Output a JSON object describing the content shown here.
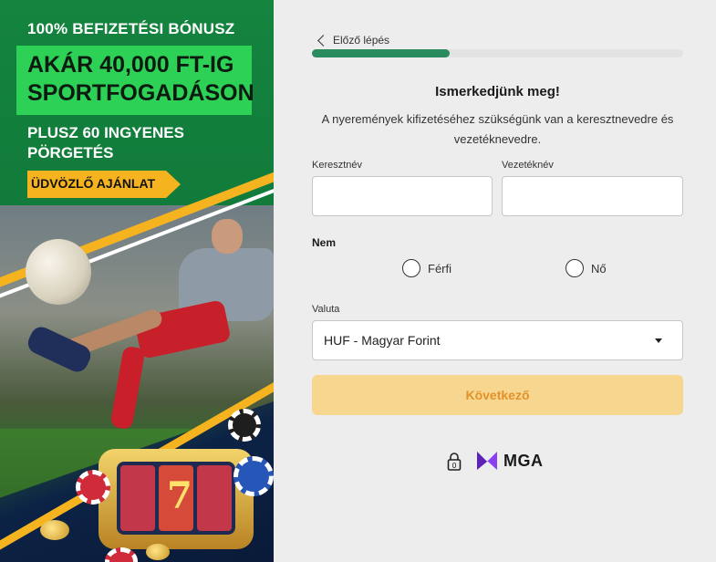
{
  "promo": {
    "kicker": "100% BEFIZETÉSI BÓNUSZ",
    "headline_line1": "AKÁR 40,000 FT-IG",
    "headline_line2": "SPORTFOGADÁSON",
    "sub_line1": "PLUSZ 60 INGYENES",
    "sub_line2": "PÖRGETÉS",
    "badge": "ÜDVÖZLŐ AJÁNLAT",
    "slot_symbol": "7",
    "colors": {
      "green": "#0f7a3a",
      "highlight": "#2dd155",
      "badge": "#f5b31f"
    }
  },
  "form": {
    "back_label": "Előző lépés",
    "progress": 0.37,
    "title": "Ismerkedjünk meg!",
    "description": "A nyeremények kifizetéséhez szükségünk van a keresztnevedre és vezetéknevedre.",
    "first_name": {
      "label": "Keresztnév",
      "value": "",
      "placeholder": ""
    },
    "last_name": {
      "label": "Vezetéknév",
      "value": "",
      "placeholder": ""
    },
    "gender": {
      "label": "Nem",
      "options": [
        "Férfi",
        "Nő"
      ]
    },
    "currency": {
      "label": "Valuta",
      "selected": "HUF - Magyar Forint"
    },
    "next_label": "Következő",
    "footer": {
      "regulator": "MGA"
    },
    "colors": {
      "progress": "#2a8b5e",
      "button_bg": "#f7d690",
      "button_text": "#e2922a",
      "mga_logo": "#8a3ff0"
    }
  }
}
